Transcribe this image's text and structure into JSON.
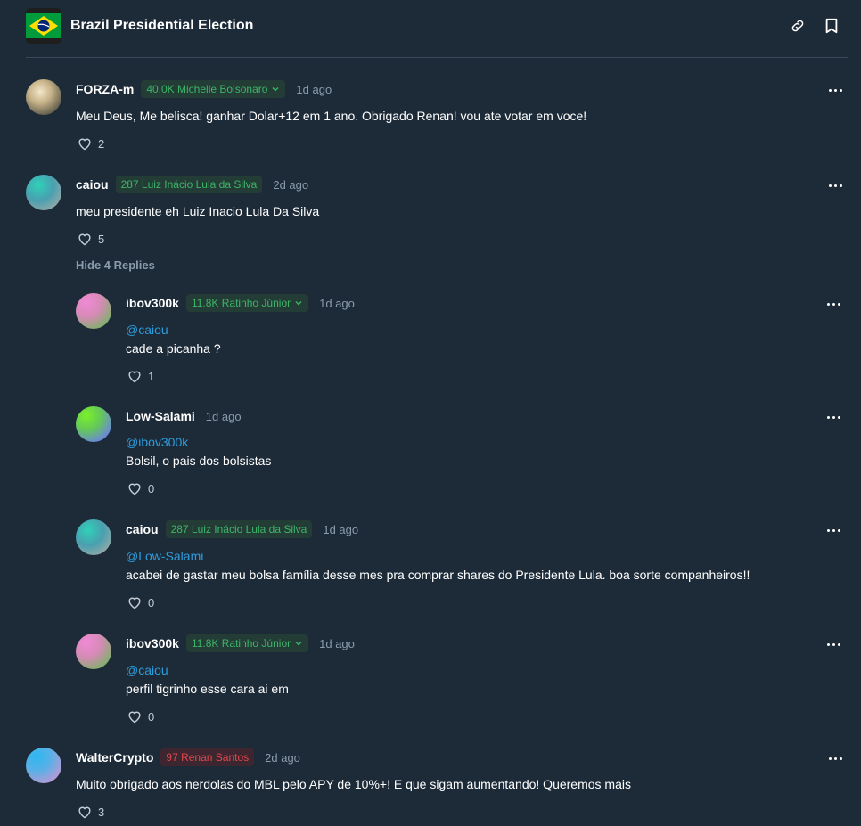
{
  "header": {
    "title": "Brazil Presidential Election",
    "flag_icon": "brazil-flag-icon",
    "actions": [
      "link-icon",
      "bookmark-icon"
    ]
  },
  "colors": {
    "background": "#1d2b39",
    "green_badge_text": "#3db468",
    "green_badge_bg": "#233d36",
    "red_badge_text": "#e0474c",
    "red_badge_bg": "#3d2630",
    "mention": "#2d9cdb",
    "muted": "#8a9bab"
  },
  "comments": [
    {
      "username": "FORZA-m",
      "badge": "40.0K Michelle Bolsonaro",
      "badge_color": "green",
      "has_dropdown": true,
      "time": "1d ago",
      "text": "Meu Deus, Me belisca! ganhar Dolar+12 em 1 ano. Obrigado Renan! vou ate votar em voce!",
      "likes": "2"
    },
    {
      "username": "caiou",
      "badge": "287 Luiz Inácio Lula da Silva",
      "badge_color": "green",
      "has_dropdown": false,
      "time": "2d ago",
      "text": "meu presidente eh Luiz Inacio Lula Da Silva",
      "likes": "5",
      "hide_replies_label": "Hide 4 Replies"
    },
    {
      "username": "WalterCrypto",
      "badge": "97 Renan Santos",
      "badge_color": "red",
      "has_dropdown": false,
      "time": "2d ago",
      "text": "Muito obrigado aos nerdolas do MBL pelo APY de 10%+! E que sigam aumentando! Queremos mais",
      "likes": "3"
    }
  ],
  "replies": [
    {
      "username": "ibov300k",
      "badge": "11.8K Ratinho Júnior",
      "badge_color": "green",
      "has_dropdown": true,
      "time": "1d ago",
      "mention": "@caiou",
      "text": "cade a picanha ?",
      "likes": "1"
    },
    {
      "username": "Low-Salami",
      "badge": "",
      "time": "1d ago",
      "mention": "@ibov300k",
      "text": "Bolsil, o pais dos bolsistas",
      "likes": "0"
    },
    {
      "username": "caiou",
      "badge": "287 Luiz Inácio Lula da Silva",
      "badge_color": "green",
      "has_dropdown": false,
      "time": "1d ago",
      "mention": "@Low-Salami",
      "text": "acabei de gastar meu bolsa família desse mes pra comprar shares do Presidente Lula. boa sorte companheiros!!",
      "likes": "0"
    },
    {
      "username": "ibov300k",
      "badge": "11.8K Ratinho Júnior",
      "badge_color": "green",
      "has_dropdown": true,
      "time": "1d ago",
      "mention": "@caiou",
      "text": "perfil tigrinho esse cara ai em",
      "likes": "0"
    }
  ]
}
